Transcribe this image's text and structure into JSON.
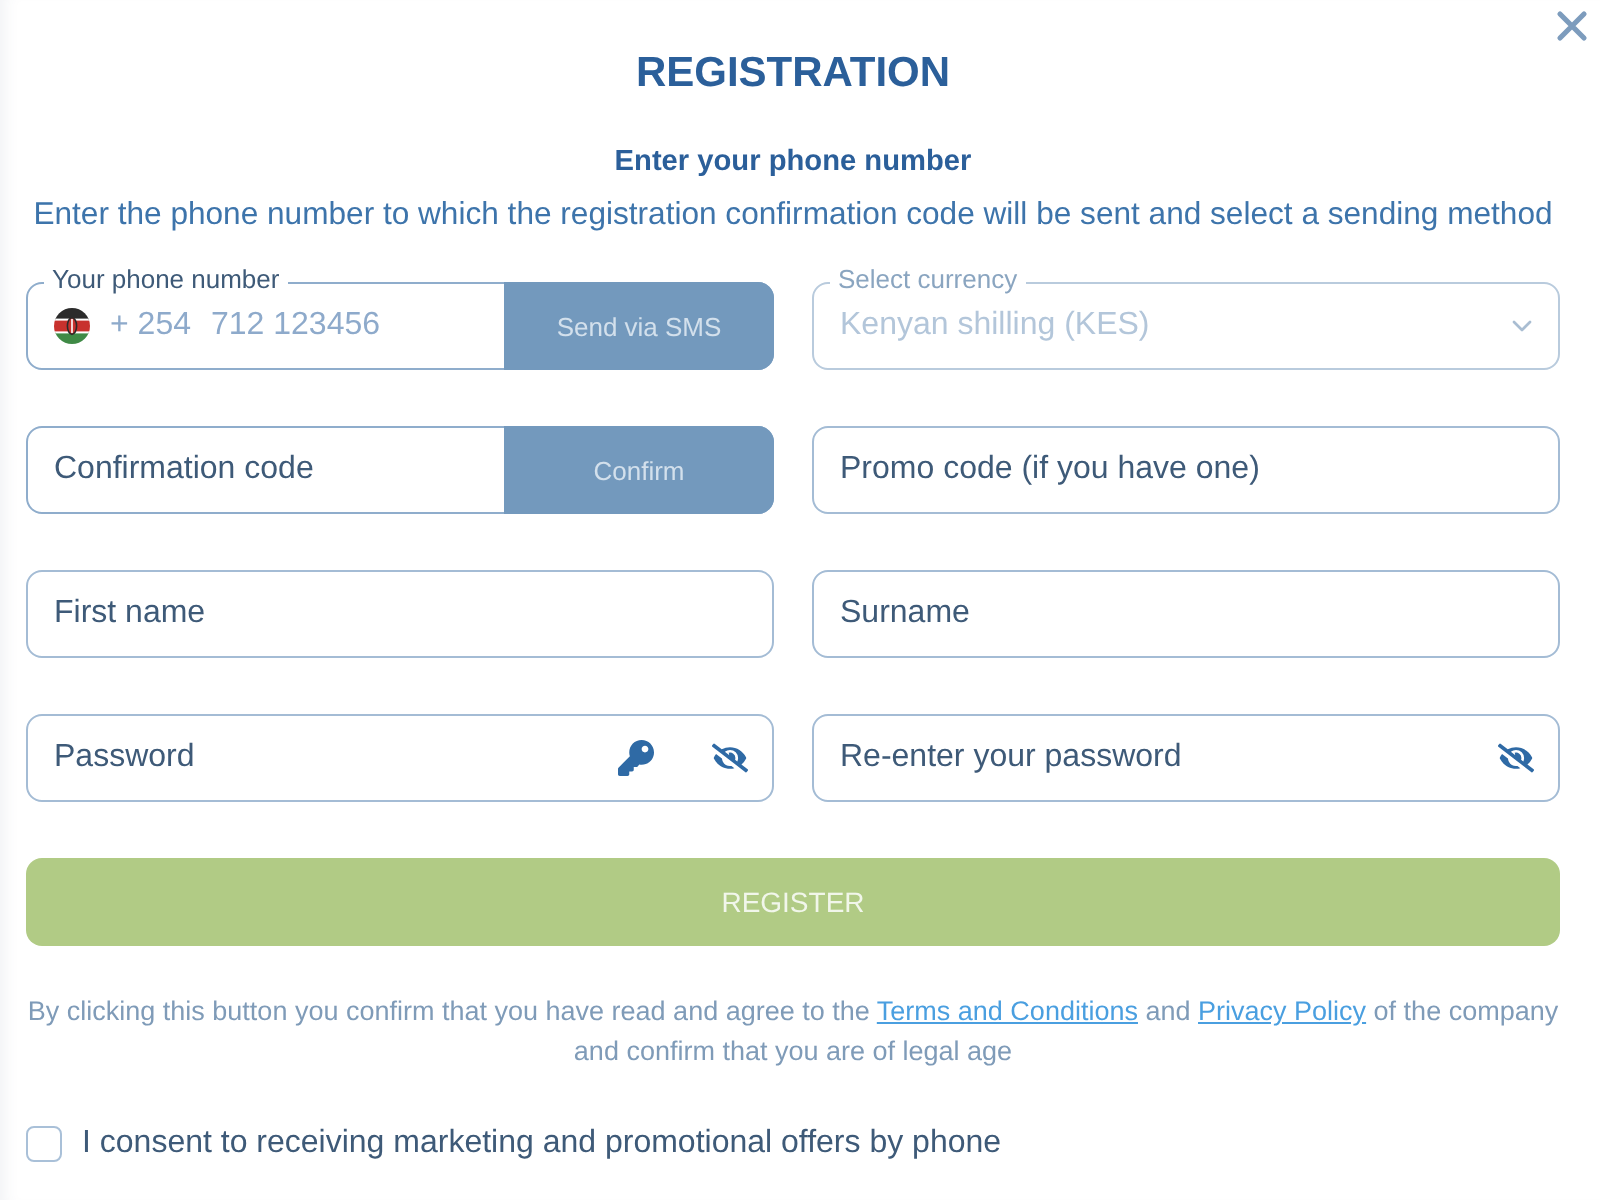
{
  "title": "REGISTRATION",
  "subtitle": "Enter your phone number",
  "description": "Enter the phone number to which the registration confirmation code will be sent and select a sending method",
  "fields": [
    {
      "kind": "phone",
      "label": "Your phone number",
      "prefix": "+ 254",
      "placeholder": "712 123456",
      "button": "Send via SMS",
      "button_disabled": true
    },
    {
      "kind": "select",
      "label": "Select currency",
      "value": "Kenyan shilling (KES)",
      "disabled": true
    },
    {
      "kind": "code",
      "placeholder": "Confirmation code",
      "button": "Confirm",
      "button_disabled": true
    },
    {
      "kind": "text",
      "placeholder": "Promo code (if you have one)"
    },
    {
      "kind": "text",
      "placeholder": "First name"
    },
    {
      "kind": "text",
      "placeholder": "Surname"
    },
    {
      "kind": "password",
      "placeholder": "Password",
      "generator": true
    },
    {
      "kind": "password",
      "placeholder": "Re-enter your password",
      "generator": false
    }
  ],
  "register": {
    "label": "REGISTER",
    "disabled": true
  },
  "legal": [
    {
      "kind": "text",
      "text": "By clicking this button you confirm that you have read and agree to the "
    },
    {
      "kind": "link",
      "text": "Terms and Conditions"
    },
    {
      "kind": "text",
      "text": " and "
    },
    {
      "kind": "link",
      "text": "Privacy Policy"
    },
    {
      "kind": "text",
      "text": " of the company and confirm that you are of legal age"
    }
  ],
  "consent": {
    "label": "I consent to receiving marketing and promotional offers by phone",
    "checked": false
  }
}
